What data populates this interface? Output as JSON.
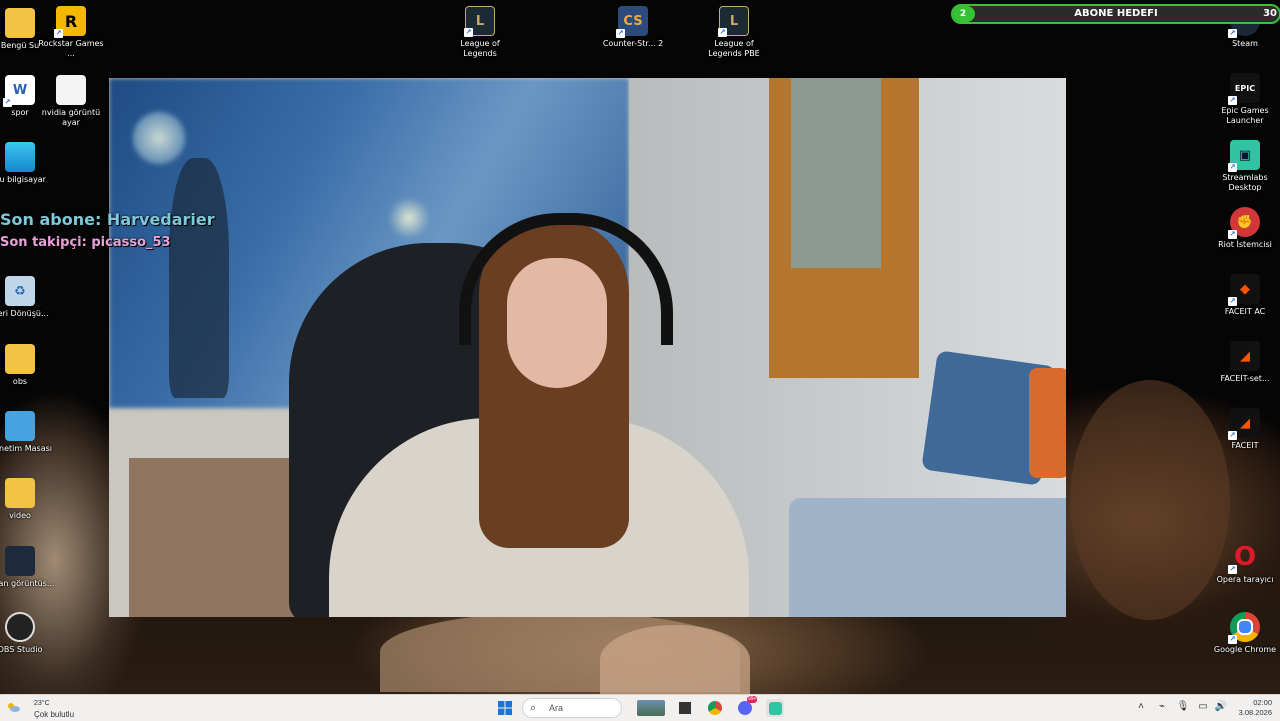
{
  "desktop_icons_left": [
    {
      "label": "Bengü Su",
      "icon": "folder-icon"
    },
    {
      "label": "Rockstar Games ...",
      "icon": "rockstar-icon"
    },
    {
      "label": "spor",
      "icon": "word-document-icon"
    },
    {
      "label": "nvidia görüntü ayar",
      "icon": "document-icon"
    },
    {
      "label": "Bu bilgisayar",
      "icon": "computer-icon"
    },
    {
      "label": "Geri Dönüşü...",
      "icon": "recycle-bin-icon"
    },
    {
      "label": "obs",
      "icon": "folder-icon"
    },
    {
      "label": "Denetim Masası",
      "icon": "control-panel-icon"
    },
    {
      "label": "video",
      "icon": "folder-icon"
    },
    {
      "label": "Ekran görüntüs...",
      "icon": "screenshot-icon"
    },
    {
      "label": "OBS Studio",
      "icon": "obs-icon"
    }
  ],
  "desktop_icons_top": [
    {
      "label": "League of Legends",
      "icon": "league-of-legends-icon"
    },
    {
      "label": "Counter-Str... 2",
      "icon": "counter-strike-icon"
    },
    {
      "label": "League of Legends PBE",
      "icon": "league-of-legends-pbe-icon"
    }
  ],
  "desktop_icons_right": [
    {
      "label": "Steam",
      "icon": "steam-icon"
    },
    {
      "label": "Epic Games Launcher",
      "icon": "epic-games-icon"
    },
    {
      "label": "Streamlabs Desktop",
      "icon": "streamlabs-icon"
    },
    {
      "label": "Riot İstemcisi",
      "icon": "riot-client-icon"
    },
    {
      "label": "FACEIT AC",
      "icon": "faceit-ac-icon"
    },
    {
      "label": "FACEIT-set...",
      "icon": "faceit-setup-icon"
    },
    {
      "label": "FACEIT",
      "icon": "faceit-icon"
    },
    {
      "label": "Opera tarayıcı",
      "icon": "opera-icon"
    },
    {
      "label": "Google Chrome",
      "icon": "chrome-icon"
    }
  ],
  "stream_overlay": {
    "last_subscriber": "Son abone: Harvedarier",
    "last_follower": "Son takipçi: picasso_53"
  },
  "subscriber_goal": {
    "title": "ABONE HEDEFI",
    "current": "2",
    "target": "30",
    "progress_fraction": 0.0667,
    "color": "#37c236"
  },
  "taskbar": {
    "weather_temp": "23°C",
    "weather_condition": "Çok bulutlu",
    "search_placeholder": "Ara",
    "clock_time": "02:00",
    "clock_date": "3.08.2026",
    "pinned": [
      "windows-start-icon",
      "search-icon",
      "news-widget-icon",
      "file-explorer-icon",
      "chrome-icon",
      "discord-icon",
      "streamlabs-icon"
    ],
    "discord_badge": "99+"
  }
}
